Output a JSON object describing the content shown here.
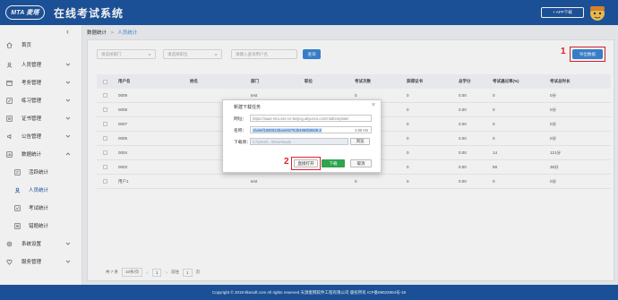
{
  "header": {
    "logo_text": "MTA 麦塔",
    "title": "在线考试系统",
    "app_download": "+ APP下载"
  },
  "sidebar": {
    "collapse_glyph": "‹",
    "items": [
      {
        "label": "首页",
        "icon": "home-icon",
        "has_arrow": false
      },
      {
        "label": "人员管理",
        "icon": "user-icon",
        "has_arrow": true
      },
      {
        "label": "考务管理",
        "icon": "calendar-icon",
        "has_arrow": true
      },
      {
        "label": "练习管理",
        "icon": "edit-icon",
        "has_arrow": true
      },
      {
        "label": "证书管理",
        "icon": "certificate-icon",
        "has_arrow": true
      },
      {
        "label": "公告管理",
        "icon": "notice-icon",
        "has_arrow": true
      },
      {
        "label": "数据统计",
        "icon": "chart-icon",
        "has_arrow": true
      },
      {
        "label": "活跃统计",
        "icon": "activity-icon",
        "sub": true
      },
      {
        "label": "人员统计",
        "icon": "person-icon",
        "sub": true,
        "active": true
      },
      {
        "label": "考试统计",
        "icon": "exam-icon",
        "sub": true
      },
      {
        "label": "错题统计",
        "icon": "error-icon",
        "sub": true
      },
      {
        "label": "系统设置",
        "icon": "settings-icon",
        "has_arrow": true
      },
      {
        "label": "服务管理",
        "icon": "service-icon",
        "has_arrow": true
      }
    ]
  },
  "breadcrumb": {
    "parent": "数据统计",
    "sep": ">",
    "current": "人员统计"
  },
  "filters": {
    "dept_placeholder": "请选择部门",
    "role_placeholder": "请选择职位",
    "search_placeholder": "请输入查询用户名",
    "search_button": "查询",
    "export_button": "导出数据"
  },
  "table": {
    "headers": [
      "用户名",
      "姓名",
      "部门",
      "职位",
      "考试次数",
      "获得证书",
      "总学分",
      "考试通过率(%)",
      "考试总时长"
    ],
    "rows": [
      [
        "0009",
        "",
        "test",
        "",
        "0",
        "0",
        "0.00",
        "0",
        "0分"
      ],
      [
        "0008",
        "",
        "test",
        "",
        "0",
        "0",
        "0.00",
        "0",
        "0分"
      ],
      [
        "0007",
        "",
        "test",
        "",
        "0",
        "0",
        "0.00",
        "0",
        "0分"
      ],
      [
        "0005",
        "",
        "test",
        "",
        "0",
        "0",
        "0.00",
        "0",
        "0分"
      ],
      [
        "0004",
        "",
        "test",
        "",
        "1",
        "0",
        "0.00",
        "14",
        "121分"
      ],
      [
        "0003",
        "",
        "test",
        "",
        "0",
        "0",
        "0.00",
        "58",
        "38分"
      ],
      [
        "用户1",
        "",
        "test",
        "",
        "0",
        "0",
        "0.00",
        "0",
        "0分"
      ]
    ]
  },
  "pager": {
    "total": "共 7 条",
    "page_size": "10条/页",
    "prev": "<",
    "page": "1",
    "next": ">",
    "goto_label": "前往",
    "goto_value": "1",
    "goto_suffix": "页"
  },
  "dialog": {
    "title": "新建下载任务",
    "close": "×",
    "url_label": "网址：",
    "url_value": "https://saas-mta.oss-cn-beijing.aliyuncs.com/ntaftemplate/",
    "name_label": "名称：",
    "name_value": "cba0ef1580024ba4e92753b4950b8509.xl",
    "name_size": "3.85 KB",
    "saveto_label": "下载到：",
    "saveto_value": "C:\\Users\\...\\Downloads",
    "browse": "浏览",
    "open_button": "直接打开",
    "download_button": "下载",
    "cancel_button": "取消"
  },
  "annotations": {
    "marker1": "1",
    "marker2": "2"
  },
  "footer": {
    "copyright": "Copyright © 2019 tlkesoft.com All rights reserved 天源麦网软件工程有限公司 版权所有 ICP备09022904号-19"
  },
  "colors": {
    "brand": "#1e56a0",
    "accent": "#3a86d6",
    "highlight": "#e0202a",
    "download_green": "#2ea44f"
  }
}
